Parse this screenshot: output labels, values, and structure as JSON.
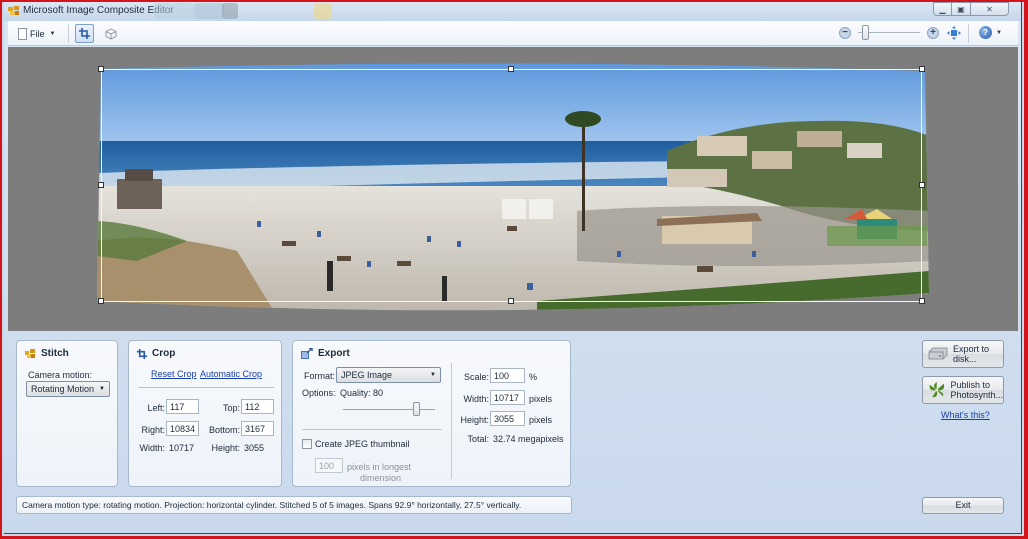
{
  "window": {
    "title": "Microsoft Image Composite Editor",
    "minimize_label": "▭",
    "restore_label": "◻",
    "close_label": "✕"
  },
  "toolbar": {
    "file_label": "File",
    "crop_tool_icon": "crop-icon",
    "cube_tool_icon": "cube-icon",
    "zoom_out_label": "−",
    "zoom_in_label": "+",
    "zoom_level_fraction": 0.12,
    "help_label": "?"
  },
  "canvas": {
    "image_description": "Panoramic beach scene with ocean, palm tree, lifeguard towers and hillside houses"
  },
  "stitch": {
    "title": "Stitch",
    "camera_motion_label": "Camera motion:",
    "camera_motion_value": "Rotating Motion"
  },
  "crop": {
    "title": "Crop",
    "reset_link": "Reset Crop",
    "auto_link": "Automatic Crop",
    "left_label": "Left:",
    "left_value": "117",
    "top_label": "Top:",
    "top_value": "112",
    "right_label": "Right:",
    "right_value": "10834",
    "bottom_label": "Bottom:",
    "bottom_value": "3167",
    "width_label": "Width:",
    "width_value": "10717",
    "height_label": "Height:",
    "height_value": "3055"
  },
  "export": {
    "title": "Export",
    "format_label": "Format:",
    "format_value": "JPEG Image",
    "options_label": "Options:",
    "quality_label": "Quality: 80",
    "quality_value": 80,
    "thumbnail_label": "Create JPEG thumbnail",
    "thumbnail_checked": false,
    "thumbnail_size": "100",
    "thumbnail_desc_1": "pixels in longest",
    "thumbnail_desc_2": "dimension",
    "scale_label": "Scale:",
    "scale_value": "100",
    "scale_unit": "%",
    "width_label": "Width:",
    "width_value": "10717",
    "width_unit": "pixels",
    "height_label": "Height:",
    "height_value": "3055",
    "height_unit": "pixels",
    "total_label": "Total:",
    "total_value": "32.74 megapixels"
  },
  "actions": {
    "export_disk_line1": "Export to",
    "export_disk_line2": "disk...",
    "publish_line1": "Publish to",
    "publish_line2": "Photosynth...",
    "whats_this": "What's this?",
    "exit": "Exit"
  },
  "status": {
    "text": "Camera motion type: rotating motion. Projection: horizontal cylinder. Stitched 5 of 5 images. Spans 92.9° horizontally, 27.5° vertically."
  }
}
